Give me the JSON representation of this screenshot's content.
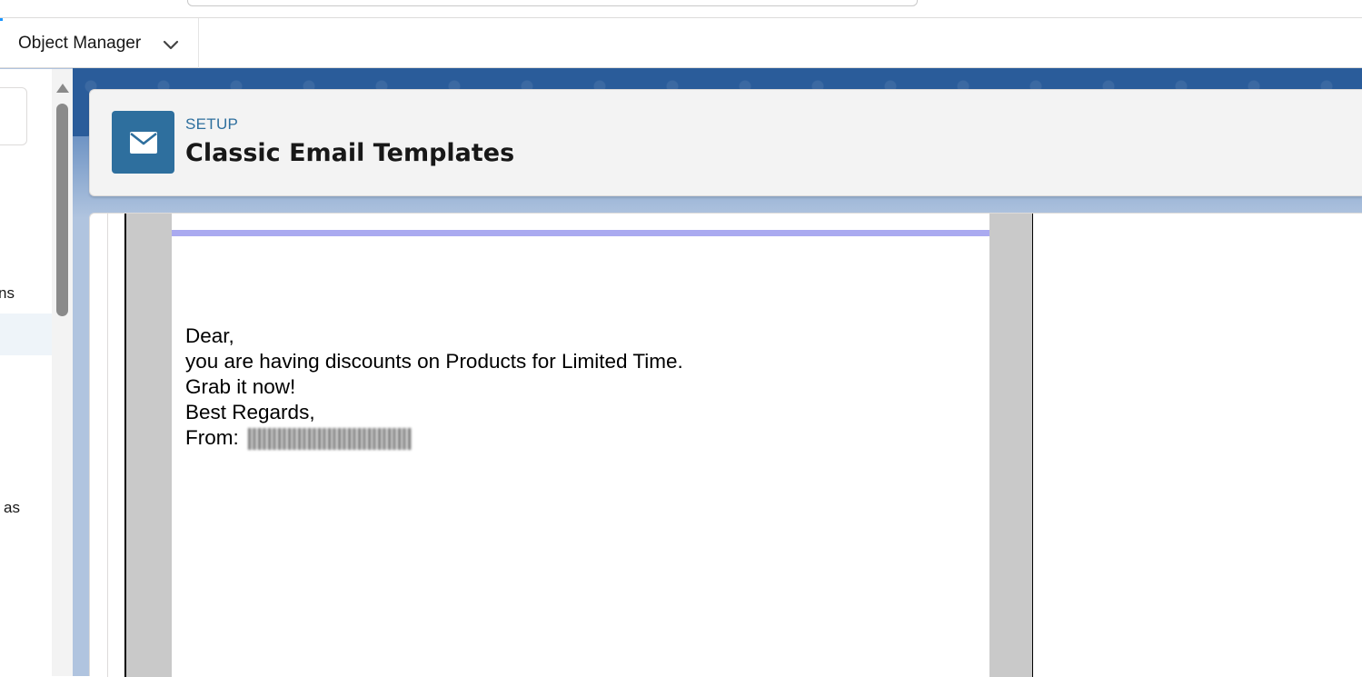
{
  "nav": {
    "object_manager_label": "Object Manager"
  },
  "sidebar": {
    "partial_items": [
      {
        "text": "ns"
      },
      {
        "text": "as"
      }
    ]
  },
  "header": {
    "eyebrow": "SETUP",
    "title": "Classic Email Templates",
    "icon": "envelope-icon"
  },
  "email_preview": {
    "lines": [
      "Dear,",
      "you are having discounts on Products for Limited Time.",
      "Grab it now!",
      "Best Regards,"
    ],
    "from_label": "From:"
  },
  "colors": {
    "accent_blue": "#2e6f9e",
    "email_accent_bar": "#aaaaf0",
    "band_blue": "#2a5c9a"
  }
}
